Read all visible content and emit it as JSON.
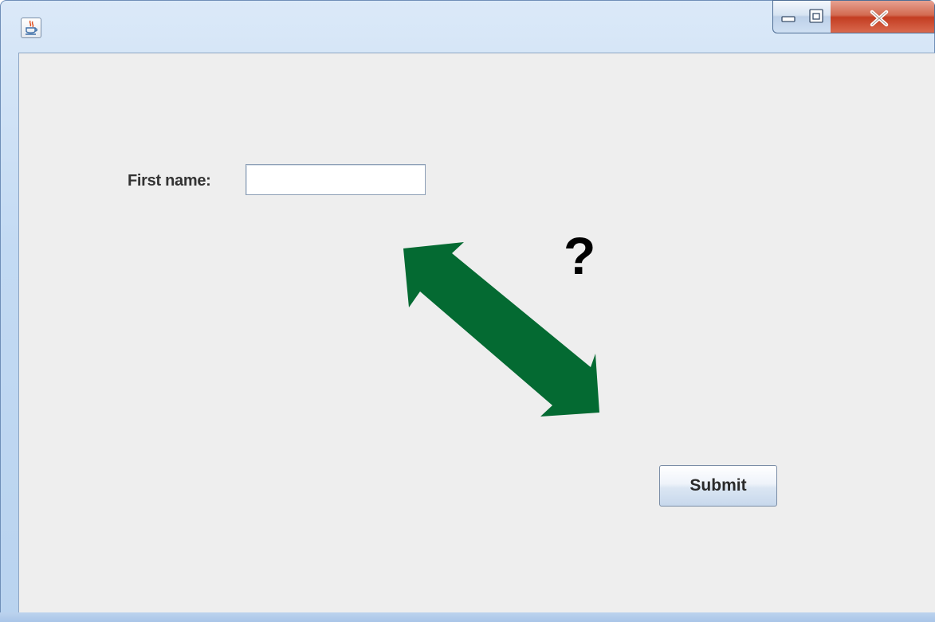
{
  "window": {
    "title": "",
    "controls": {
      "minimize": "–",
      "maximize": "▫",
      "close": "X"
    },
    "app_icon": "java-cup-icon"
  },
  "form": {
    "first_name_label": "First name:",
    "first_name_value": "",
    "first_name_placeholder": "",
    "submit_label": "Submit"
  },
  "annotation": {
    "question_mark": "?",
    "arrow_icon": "double-headed-arrow-icon",
    "arrow_color": "#046a32"
  }
}
